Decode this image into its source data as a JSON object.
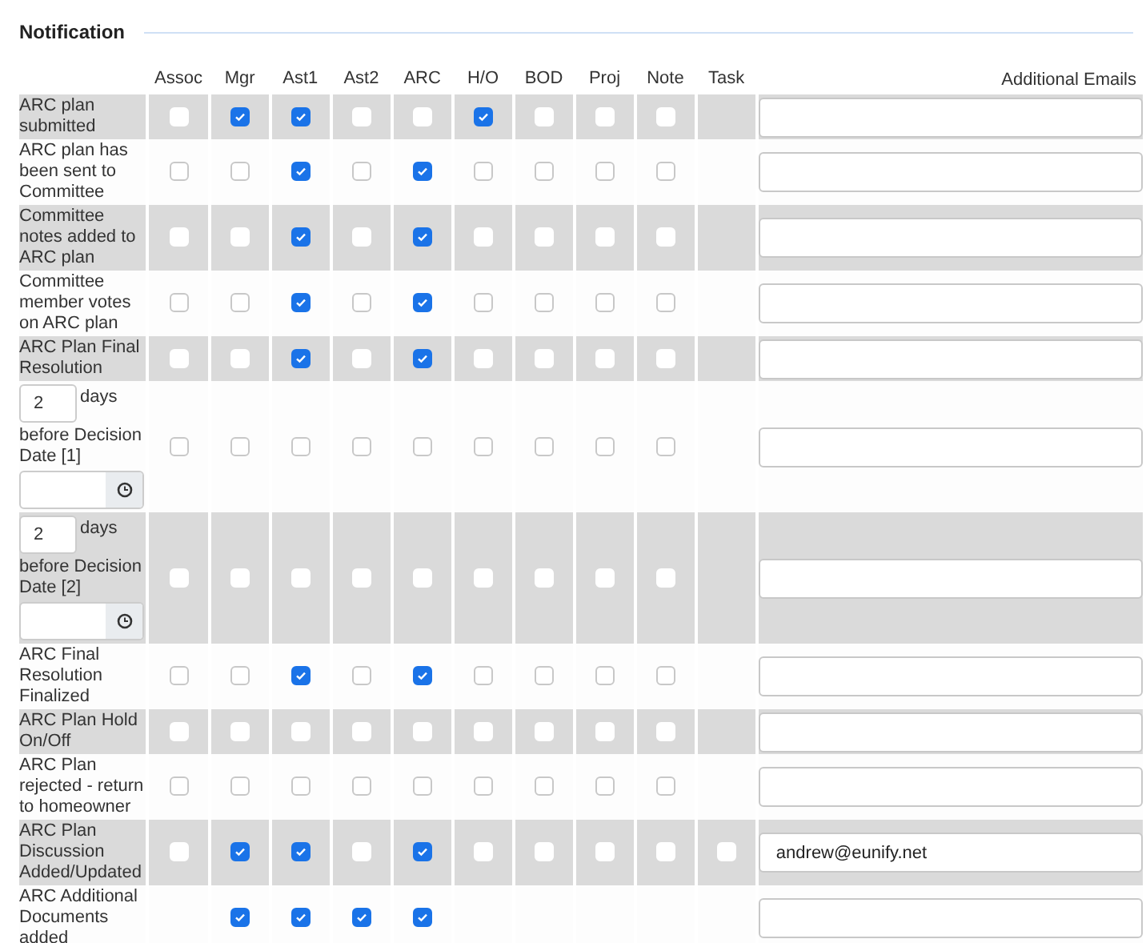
{
  "section_title": "Notification",
  "columns": [
    "Assoc",
    "Mgr",
    "Ast1",
    "Ast2",
    "ARC",
    "H/O",
    "BOD",
    "Proj",
    "Note",
    "Task"
  ],
  "emails_heading": "Additional Emails",
  "rows": [
    {
      "kind": "text",
      "label": "ARC plan submitted",
      "cells": [
        {
          "kind": "checkbox",
          "checked": false
        },
        {
          "kind": "checkbox",
          "checked": true
        },
        {
          "kind": "checkbox",
          "checked": true
        },
        {
          "kind": "checkbox",
          "checked": false
        },
        {
          "kind": "checkbox",
          "checked": false
        },
        {
          "kind": "checkbox",
          "checked": true
        },
        {
          "kind": "checkbox",
          "checked": false
        },
        {
          "kind": "checkbox",
          "checked": false
        },
        {
          "kind": "checkbox",
          "checked": false
        },
        {
          "kind": "empty"
        }
      ],
      "email": {}
    },
    {
      "kind": "text",
      "label": "ARC plan has been sent to Committee",
      "cells": [
        {
          "kind": "checkbox",
          "checked": false
        },
        {
          "kind": "checkbox",
          "checked": false
        },
        {
          "kind": "checkbox",
          "checked": true
        },
        {
          "kind": "checkbox",
          "checked": false
        },
        {
          "kind": "checkbox",
          "checked": true
        },
        {
          "kind": "checkbox",
          "checked": false
        },
        {
          "kind": "checkbox",
          "checked": false
        },
        {
          "kind": "checkbox",
          "checked": false
        },
        {
          "kind": "checkbox",
          "checked": false
        },
        {
          "kind": "empty"
        }
      ],
      "email": {}
    },
    {
      "kind": "text",
      "label": "Committee notes added to ARC plan",
      "cells": [
        {
          "kind": "checkbox",
          "checked": false
        },
        {
          "kind": "checkbox",
          "checked": false
        },
        {
          "kind": "checkbox",
          "checked": true
        },
        {
          "kind": "checkbox",
          "checked": false
        },
        {
          "kind": "checkbox",
          "checked": true
        },
        {
          "kind": "checkbox",
          "checked": false
        },
        {
          "kind": "checkbox",
          "checked": false
        },
        {
          "kind": "checkbox",
          "checked": false
        },
        {
          "kind": "checkbox",
          "checked": false
        },
        {
          "kind": "empty"
        }
      ],
      "email": {}
    },
    {
      "kind": "text",
      "label": "Committee member votes on ARC plan",
      "cells": [
        {
          "kind": "checkbox",
          "checked": false
        },
        {
          "kind": "checkbox",
          "checked": false
        },
        {
          "kind": "checkbox",
          "checked": true
        },
        {
          "kind": "checkbox",
          "checked": false
        },
        {
          "kind": "checkbox",
          "checked": true
        },
        {
          "kind": "checkbox",
          "checked": false
        },
        {
          "kind": "checkbox",
          "checked": false
        },
        {
          "kind": "checkbox",
          "checked": false
        },
        {
          "kind": "checkbox",
          "checked": false
        },
        {
          "kind": "empty"
        }
      ],
      "email": {}
    },
    {
      "kind": "text",
      "label": "ARC Plan Final Resolution",
      "cells": [
        {
          "kind": "checkbox",
          "checked": false
        },
        {
          "kind": "checkbox",
          "checked": false
        },
        {
          "kind": "checkbox",
          "checked": true
        },
        {
          "kind": "checkbox",
          "checked": false
        },
        {
          "kind": "checkbox",
          "checked": true
        },
        {
          "kind": "checkbox",
          "checked": false
        },
        {
          "kind": "checkbox",
          "checked": false
        },
        {
          "kind": "checkbox",
          "checked": false
        },
        {
          "kind": "checkbox",
          "checked": false
        },
        {
          "kind": "empty"
        }
      ],
      "email": {}
    },
    {
      "kind": "days",
      "days_value": "2",
      "days_unit": "days",
      "label": "before Decision Date [1]",
      "cells": [
        {
          "kind": "checkbox",
          "checked": false
        },
        {
          "kind": "checkbox",
          "checked": false
        },
        {
          "kind": "checkbox",
          "checked": false
        },
        {
          "kind": "checkbox",
          "checked": false
        },
        {
          "kind": "checkbox",
          "checked": false
        },
        {
          "kind": "checkbox",
          "checked": false
        },
        {
          "kind": "checkbox",
          "checked": false
        },
        {
          "kind": "checkbox",
          "checked": false
        },
        {
          "kind": "checkbox",
          "checked": false
        },
        {
          "kind": "empty"
        }
      ],
      "email": {}
    },
    {
      "kind": "days",
      "days_value": "2",
      "days_unit": "days",
      "label": "before Decision Date [2]",
      "cells": [
        {
          "kind": "checkbox",
          "checked": false
        },
        {
          "kind": "checkbox",
          "checked": false
        },
        {
          "kind": "checkbox",
          "checked": false
        },
        {
          "kind": "checkbox",
          "checked": false
        },
        {
          "kind": "checkbox",
          "checked": false
        },
        {
          "kind": "checkbox",
          "checked": false
        },
        {
          "kind": "checkbox",
          "checked": false
        },
        {
          "kind": "checkbox",
          "checked": false
        },
        {
          "kind": "checkbox",
          "checked": false
        },
        {
          "kind": "empty"
        }
      ],
      "email": {}
    },
    {
      "kind": "text",
      "label": "ARC Final Resolution Finalized",
      "cells": [
        {
          "kind": "checkbox",
          "checked": false
        },
        {
          "kind": "checkbox",
          "checked": false
        },
        {
          "kind": "checkbox",
          "checked": true
        },
        {
          "kind": "checkbox",
          "checked": false
        },
        {
          "kind": "checkbox",
          "checked": true
        },
        {
          "kind": "checkbox",
          "checked": false
        },
        {
          "kind": "checkbox",
          "checked": false
        },
        {
          "kind": "checkbox",
          "checked": false
        },
        {
          "kind": "checkbox",
          "checked": false
        },
        {
          "kind": "empty"
        }
      ],
      "email": {}
    },
    {
      "kind": "text",
      "label": "ARC Plan Hold On/Off",
      "cells": [
        {
          "kind": "checkbox",
          "checked": false
        },
        {
          "kind": "checkbox",
          "checked": false
        },
        {
          "kind": "checkbox",
          "checked": false
        },
        {
          "kind": "checkbox",
          "checked": false
        },
        {
          "kind": "checkbox",
          "checked": false
        },
        {
          "kind": "checkbox",
          "checked": false
        },
        {
          "kind": "checkbox",
          "checked": false
        },
        {
          "kind": "checkbox",
          "checked": false
        },
        {
          "kind": "checkbox",
          "checked": false
        },
        {
          "kind": "empty"
        }
      ],
      "email": {}
    },
    {
      "kind": "text",
      "label": "ARC Plan rejected - return to homeowner",
      "cells": [
        {
          "kind": "checkbox",
          "checked": false
        },
        {
          "kind": "checkbox",
          "checked": false
        },
        {
          "kind": "checkbox",
          "checked": false
        },
        {
          "kind": "checkbox",
          "checked": false
        },
        {
          "kind": "checkbox",
          "checked": false
        },
        {
          "kind": "checkbox",
          "checked": false
        },
        {
          "kind": "checkbox",
          "checked": false
        },
        {
          "kind": "checkbox",
          "checked": false
        },
        {
          "kind": "checkbox",
          "checked": false
        },
        {
          "kind": "empty"
        }
      ],
      "email": {}
    },
    {
      "kind": "text",
      "label": "ARC Plan Discussion Added/Updated",
      "cells": [
        {
          "kind": "checkbox",
          "checked": false
        },
        {
          "kind": "checkbox",
          "checked": true
        },
        {
          "kind": "checkbox",
          "checked": true
        },
        {
          "kind": "checkbox",
          "checked": false
        },
        {
          "kind": "checkbox",
          "checked": true
        },
        {
          "kind": "checkbox",
          "checked": false
        },
        {
          "kind": "checkbox",
          "checked": false
        },
        {
          "kind": "checkbox",
          "checked": false
        },
        {
          "kind": "checkbox",
          "checked": false
        },
        {
          "kind": "checkbox",
          "checked": false
        }
      ],
      "email": {
        "value": "andrew@eunify.net"
      }
    },
    {
      "kind": "text",
      "label": "ARC Additional Documents added",
      "cells": [
        {
          "kind": "empty"
        },
        {
          "kind": "checkbox",
          "checked": true
        },
        {
          "kind": "checkbox",
          "checked": true
        },
        {
          "kind": "checkbox",
          "checked": true
        },
        {
          "kind": "checkbox",
          "checked": true
        },
        {
          "kind": "empty"
        },
        {
          "kind": "empty"
        },
        {
          "kind": "empty"
        },
        {
          "kind": "empty"
        },
        {
          "kind": "empty"
        }
      ],
      "email": {}
    }
  ]
}
